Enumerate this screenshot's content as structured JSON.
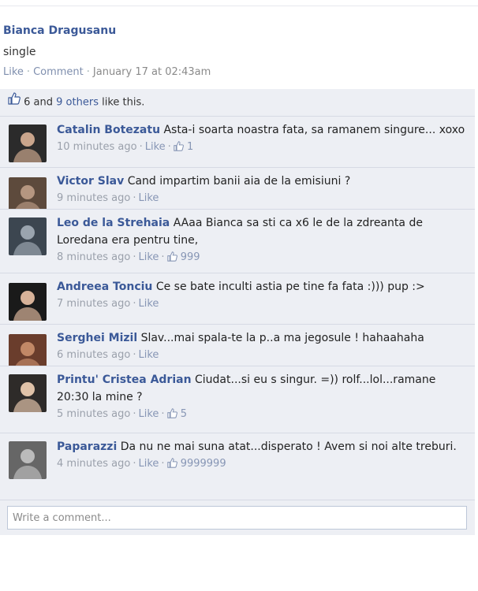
{
  "post": {
    "author": "Bianca Dragusanu",
    "status": "single",
    "actions": {
      "like": "Like",
      "comment": "Comment",
      "timestamp": "January 17 at 02:43am"
    },
    "likes": {
      "count_text": "6 and",
      "others_link": "9 others",
      "suffix": "like this."
    }
  },
  "comments": [
    {
      "name": "Catalin Botezatu",
      "text": "Asta-i soarta noastra fata, sa ramanem singure... xoxo",
      "time": "10 minutes ago",
      "like": "Like",
      "likes_count": "1"
    },
    {
      "name": "Victor Slav",
      "text": "Cand impartim banii aia de la emisiuni ?",
      "time": "9 minutes ago",
      "like": "Like",
      "likes_count": ""
    },
    {
      "name": "Leo de la Strehaia",
      "text": "AAaa Bianca sa sti ca x6 le de la zdreanta de Loredana era pentru tine,",
      "time": "8 minutes ago",
      "like": "Like",
      "likes_count": "999"
    },
    {
      "name": "Andreea Tonciu",
      "text": "Ce se bate inculti astia pe tine fa fata :)))  pup :>",
      "time": "7 minutes ago",
      "like": "Like",
      "likes_count": ""
    },
    {
      "name": "Serghei Mizil",
      "text": "Slav...mai spala-te la p..a ma jegosule !  hahaahaha",
      "time": "6 minutes ago",
      "like": "Like",
      "likes_count": ""
    },
    {
      "name": "Printu' Cristea Adrian",
      "text": "Ciudat...si eu s singur. =)) rolf...lol...ramane 20:30 la mine ?",
      "time": "5 minutes ago",
      "like": "Like",
      "likes_count": "5"
    },
    {
      "name": "Paparazzi",
      "text": "Da nu ne mai suna atat...disperato ! Avem si noi alte treburi.",
      "time": "4 minutes ago",
      "like": "Like",
      "likes_count": "9999999"
    }
  ],
  "composer": {
    "placeholder": "Write a comment..."
  },
  "colors": {
    "link": "#3b5998",
    "feedback_bg": "#edeff4",
    "meta": "#9aa0ab"
  }
}
